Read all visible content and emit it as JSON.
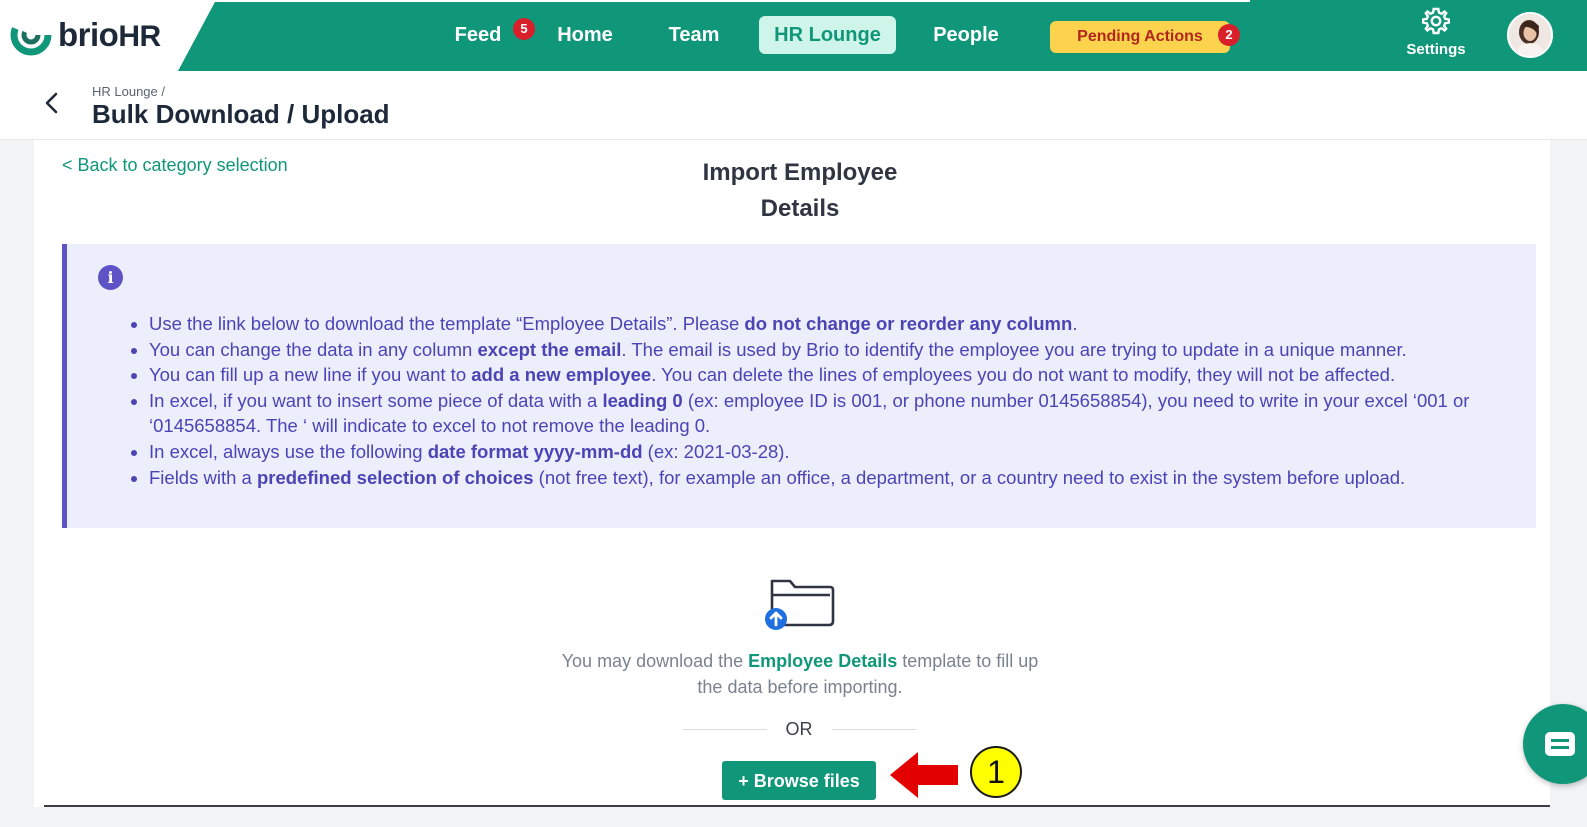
{
  "brand": {
    "logo_main": "brio",
    "logo_suffix": "HR"
  },
  "nav": {
    "items": [
      {
        "label": "Feed",
        "badge": "5"
      },
      {
        "label": "Home"
      },
      {
        "label": "Team"
      },
      {
        "label": "HR Lounge",
        "active": true
      },
      {
        "label": "People"
      }
    ],
    "pending_actions": {
      "label": "Pending Actions",
      "badge": "2"
    },
    "settings_label": "Settings"
  },
  "header": {
    "breadcrumb": "HR Lounge /",
    "title": "Bulk Download / Upload"
  },
  "content": {
    "back_link": "< Back to category selection",
    "section_title_line1": "Import Employee",
    "section_title_line2": "Details",
    "info_icon": "i",
    "info_items": [
      [
        {
          "t": "Use the link below to download the template “Employee Details”. Please "
        },
        {
          "t": "do not change or reorder any column",
          "b": true
        },
        {
          "t": "."
        }
      ],
      [
        {
          "t": "You can change the data in any column "
        },
        {
          "t": "except the email",
          "b": true
        },
        {
          "t": ". The email is used by Brio to identify the employee you are trying to update in a unique manner."
        }
      ],
      [
        {
          "t": "You can fill up a new line if you want to "
        },
        {
          "t": "add a new employee",
          "b": true
        },
        {
          "t": ". You can delete the lines of employees you do not want to modify, they will not be affected."
        }
      ],
      [
        {
          "t": "In excel, if you want to insert some piece of data with a "
        },
        {
          "t": "leading 0",
          "b": true
        },
        {
          "t": " (ex: employee ID is 001, or phone number 0145658854), you need to write in your excel ‘001 or ‘0145658854. The ‘ will indicate to excel to not remove the leading 0."
        }
      ],
      [
        {
          "t": "In excel, always use the following "
        },
        {
          "t": "date format yyyy-mm-dd",
          "b": true
        },
        {
          "t": " (ex: 2021-03-28)."
        }
      ],
      [
        {
          "t": "Fields with a "
        },
        {
          "t": "predefined selection of choices",
          "b": true
        },
        {
          "t": " (not free text), for example an office, a department, or a country need to exist in the system before upload."
        }
      ]
    ],
    "download_prefix": "You may download the ",
    "download_link": "Employee Details",
    "download_suffix": " template to fill up the data before importing.",
    "or_text": "OR",
    "browse_button": "+ Browse files",
    "step_number": "1"
  },
  "colors": {
    "brand_green": "#10977a",
    "info_purple": "#5d53c7",
    "info_bg": "#eceefb",
    "badge_red": "#d91f2a",
    "pending_yellow": "#fbd34d",
    "annotation_red": "#e30000",
    "annotation_yellow": "#ffff00"
  },
  "icons": [
    "brio-logo-icon",
    "settings-gear-icon",
    "back-chevron-icon",
    "info-icon",
    "folder-upload-icon",
    "red-arrow-icon",
    "chat-icon"
  ]
}
